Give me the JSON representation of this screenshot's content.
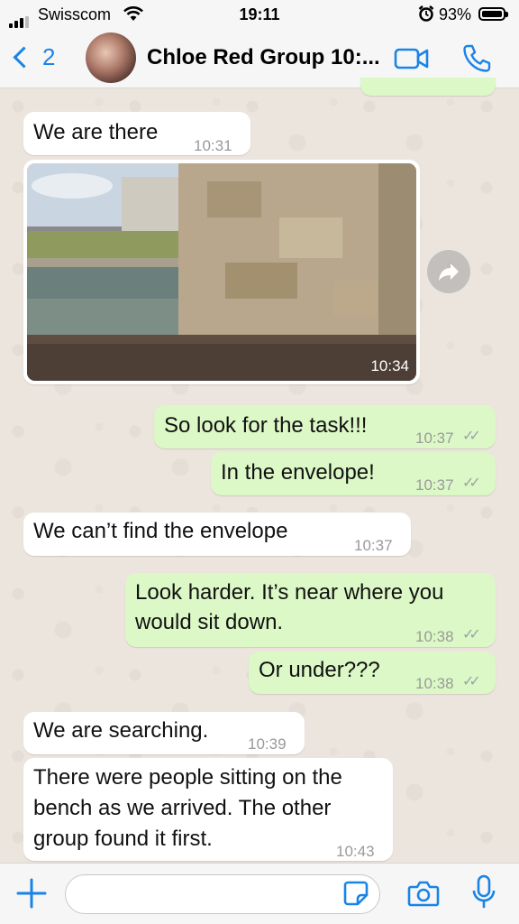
{
  "status_bar": {
    "carrier": "Swisscom",
    "time": "19:11",
    "battery": "93%"
  },
  "header": {
    "back_count": "2",
    "title": "Chloe Red Group 10:..."
  },
  "messages": [
    {
      "direction": "in",
      "text": "We are there",
      "time": "10:31"
    },
    {
      "direction": "in",
      "type": "image",
      "time": "10:34"
    },
    {
      "direction": "out",
      "text": "So look for the task!!!",
      "time": "10:37"
    },
    {
      "direction": "out",
      "text": "In the envelope!",
      "time": "10:37"
    },
    {
      "direction": "in",
      "text": "We can’t find the envelope",
      "time": "10:37"
    },
    {
      "direction": "out",
      "text_lines": [
        "Look harder. It’s near where you",
        "would sit down."
      ],
      "time": "10:38"
    },
    {
      "direction": "out",
      "text": "Or under???",
      "time": "10:38"
    },
    {
      "direction": "in",
      "text": "We are searching.",
      "time": "10:39"
    },
    {
      "direction": "in",
      "text_lines": [
        "There were people sitting on the",
        "bench as we arrived. The other",
        "group found it first."
      ],
      "time": "10:43"
    }
  ],
  "colors": {
    "accent": "#1a84e6",
    "incoming_bubble": "#ffffff",
    "outgoing_bubble": "#dcf8c6",
    "wallpaper": "#ece5dd"
  },
  "composer": {
    "value": ""
  }
}
